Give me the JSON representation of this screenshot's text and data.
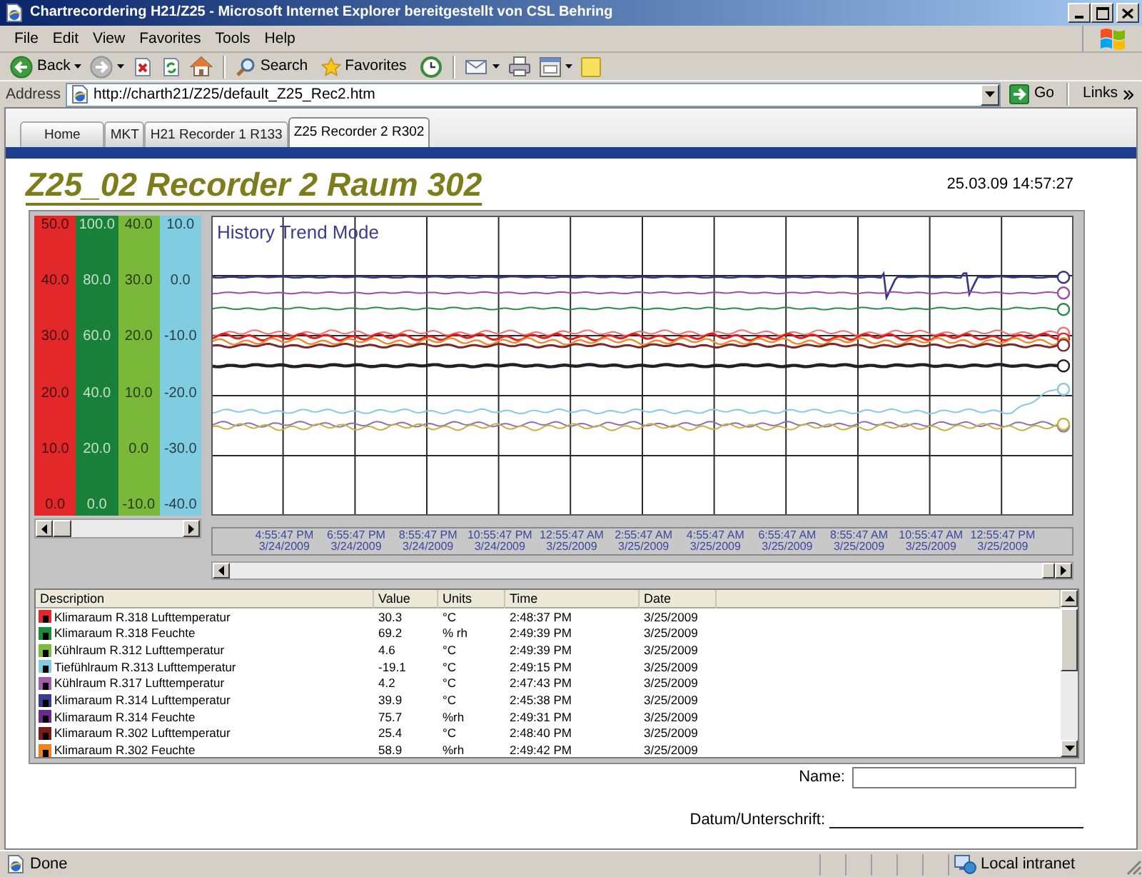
{
  "window": {
    "title": "Chartrecordering H21/Z25 - Microsoft Internet Explorer bereitgestellt von CSL Behring"
  },
  "menu": [
    "File",
    "Edit",
    "View",
    "Favorites",
    "Tools",
    "Help"
  ],
  "toolbar": {
    "back": "Back",
    "search": "Search",
    "favorites": "Favorites"
  },
  "address_bar": {
    "label": "Address",
    "url": "http://charth21/Z25/default_Z25_Rec2.htm",
    "go": "Go",
    "links": "Links"
  },
  "tabs": [
    {
      "label": "Home",
      "selected": false
    },
    {
      "label": "MKT",
      "selected": false
    },
    {
      "label": "H21 Recorder 1 R133",
      "selected": false
    },
    {
      "label": "Z25 Recorder 2 R302",
      "selected": true
    }
  ],
  "page_title": "Z25_02 Recorder 2 Raum 302",
  "timestamp": "25.03.09 14:57:27",
  "chart": {
    "title": "History Trend Mode",
    "scales": [
      {
        "color": "#e22828",
        "labels": [
          "50.0",
          "40.0",
          "30.0",
          "20.0",
          "10.0",
          "0.0"
        ]
      },
      {
        "color": "#188038",
        "labels": [
          "100.0",
          "80.0",
          "60.0",
          "40.0",
          "20.0",
          "0.0"
        ]
      },
      {
        "color": "#7ab83a",
        "labels": [
          "40.0",
          "30.0",
          "20.0",
          "10.0",
          "0.0",
          "-10.0"
        ]
      },
      {
        "color": "#80cce0",
        "labels": [
          "10.0",
          "0.0",
          "-10.0",
          "-20.0",
          "-30.0",
          "-40.0"
        ]
      }
    ],
    "time_labels": [
      {
        "time": "4:55:47 PM",
        "date": "3/24/2009"
      },
      {
        "time": "6:55:47 PM",
        "date": "3/24/2009"
      },
      {
        "time": "8:55:47 PM",
        "date": "3/24/2009"
      },
      {
        "time": "10:55:47 PM",
        "date": "3/24/2009"
      },
      {
        "time": "12:55:47 AM",
        "date": "3/25/2009"
      },
      {
        "time": "2:55:47 AM",
        "date": "3/25/2009"
      },
      {
        "time": "4:55:47 AM",
        "date": "3/25/2009"
      },
      {
        "time": "6:55:47 AM",
        "date": "3/25/2009"
      },
      {
        "time": "8:55:47 AM",
        "date": "3/25/2009"
      },
      {
        "time": "10:55:47 AM",
        "date": "3/25/2009"
      },
      {
        "time": "12:55:47 PM",
        "date": "3/25/2009"
      }
    ]
  },
  "table": {
    "columns": [
      "Description",
      "Value",
      "Units",
      "Time",
      "Date"
    ],
    "rows": [
      {
        "color": "#e02828",
        "description": "Klimaraum R.318 Lufttemperatur",
        "value": "30.3",
        "units": "°C",
        "time": "2:48:37 PM",
        "date": "3/25/2009"
      },
      {
        "color": "#1b8a3a",
        "description": "Klimaraum R.318 Feuchte",
        "value": "69.2",
        "units": "% rh",
        "time": "2:49:39 PM",
        "date": "3/25/2009"
      },
      {
        "color": "#7cbc3c",
        "description": "Kühlraum R.312 Lufttemperatur",
        "value": "4.6",
        "units": "°C",
        "time": "2:49:39 PM",
        "date": "3/25/2009"
      },
      {
        "color": "#80cce0",
        "description": "Tiefühlraum R.313 Lufttemperatur",
        "value": "-19.1",
        "units": "°C",
        "time": "2:49:15 PM",
        "date": "3/25/2009"
      },
      {
        "color": "#a060a8",
        "description": "Kühlraum R.317 Lufttemperatur",
        "value": "4.2",
        "units": "°C",
        "time": "2:47:43 PM",
        "date": "3/25/2009"
      },
      {
        "color": "#3a3a90",
        "description": "Klimaraum R.314 Lufttemperatur",
        "value": "39.9",
        "units": "°C",
        "time": "2:45:38 PM",
        "date": "3/25/2009"
      },
      {
        "color": "#6a2a8a",
        "description": "Klimaraum R.314 Feuchte",
        "value": "75.7",
        "units": "%rh",
        "time": "2:49:31 PM",
        "date": "3/25/2009"
      },
      {
        "color": "#7a1a1a",
        "description": "Klimaraum R.302 Lufttemperatur",
        "value": "25.4",
        "units": "°C",
        "time": "2:48:40 PM",
        "date": "3/25/2009"
      },
      {
        "color": "#f08020",
        "description": "Klimaraum R.302 Feuchte",
        "value": "58.9",
        "units": "%rh",
        "time": "2:49:42 PM",
        "date": "3/25/2009"
      }
    ]
  },
  "signature_form": {
    "name_label": "Name:",
    "date_label": "Datum/Unterschrift:"
  },
  "status_bar": {
    "text": "Done",
    "zone": "Local intranet"
  }
}
